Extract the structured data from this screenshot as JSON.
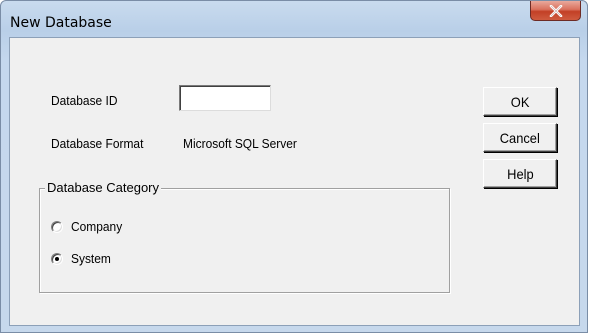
{
  "window": {
    "title": "New Database",
    "close_glyph": "close-icon"
  },
  "form": {
    "database_id_label": "Database ID",
    "database_id_value": "",
    "database_format_label": "Database Format",
    "database_format_value": "Microsoft SQL Server"
  },
  "buttons": {
    "ok_label": "OK",
    "cancel_label": "Cancel",
    "help_label": "Help"
  },
  "category": {
    "legend": "Database Category",
    "options": [
      {
        "label": "Company",
        "selected": false
      },
      {
        "label": "System",
        "selected": true
      }
    ]
  },
  "colors": {
    "close_button": "#c24026",
    "dialog_background": "#f0f0f0",
    "frame": "#c6d8ec"
  }
}
